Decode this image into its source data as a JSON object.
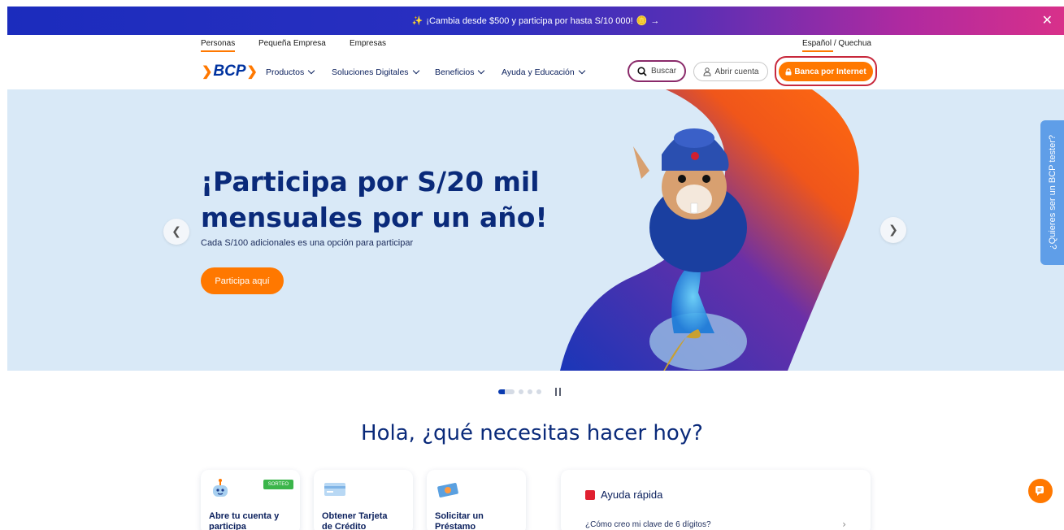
{
  "promo": {
    "text": "¡Cambia desde $500 y participa por hasta S/10 000!",
    "arrow": "→",
    "close_icon": "close-icon",
    "colors": {
      "start": "#1b2cbd",
      "end": "#d8308a"
    }
  },
  "top_tabs": {
    "personas": "Personas",
    "pequena_empresa": "Pequeña Empresa",
    "empresas": "Empresas",
    "language": "Español / Quechua"
  },
  "nav": {
    "logo": "BCP",
    "items": [
      {
        "label": "Productos"
      },
      {
        "label": "Soluciones Digitales"
      },
      {
        "label": "Beneficios"
      },
      {
        "label": "Ayuda y Educación"
      }
    ],
    "search_label": "Buscar",
    "open_account_label": "Abrir cuenta",
    "bank_label": "Banca por Internet",
    "accent": "#ff7800",
    "brand": "#0033a0"
  },
  "hero": {
    "title_line1": "¡Participa por S/20 mil",
    "title_line2": "mensuales por un año!",
    "subtitle": "Cada S/100 adicionales es una opción para participar",
    "cta": "Participa aquí",
    "prev_icon": "chevron-left-icon",
    "next_icon": "chevron-right-icon"
  },
  "tester": {
    "label": "¿Quieres ser un BCP tester?"
  },
  "carousel": {
    "slides": 5,
    "active": 1
  },
  "main": {
    "title": "Hola, ¿qué necesitas hacer hoy?",
    "cards": [
      {
        "label_line1": "Abre tu cuenta y",
        "label_line2": "participa",
        "badge": "SORTEO",
        "icon": "robot-icon"
      },
      {
        "label_line1": "Obtener Tarjeta",
        "label_line2": "de Crédito",
        "icon": "credit-card-icon"
      },
      {
        "label_line1": "Solicitar un",
        "label_line2": "Préstamo",
        "icon": "money-icon"
      }
    ],
    "help": {
      "title": "Ayuda rápida",
      "question": "¿Cómo creo mi clave de 6 dígitos?"
    }
  }
}
